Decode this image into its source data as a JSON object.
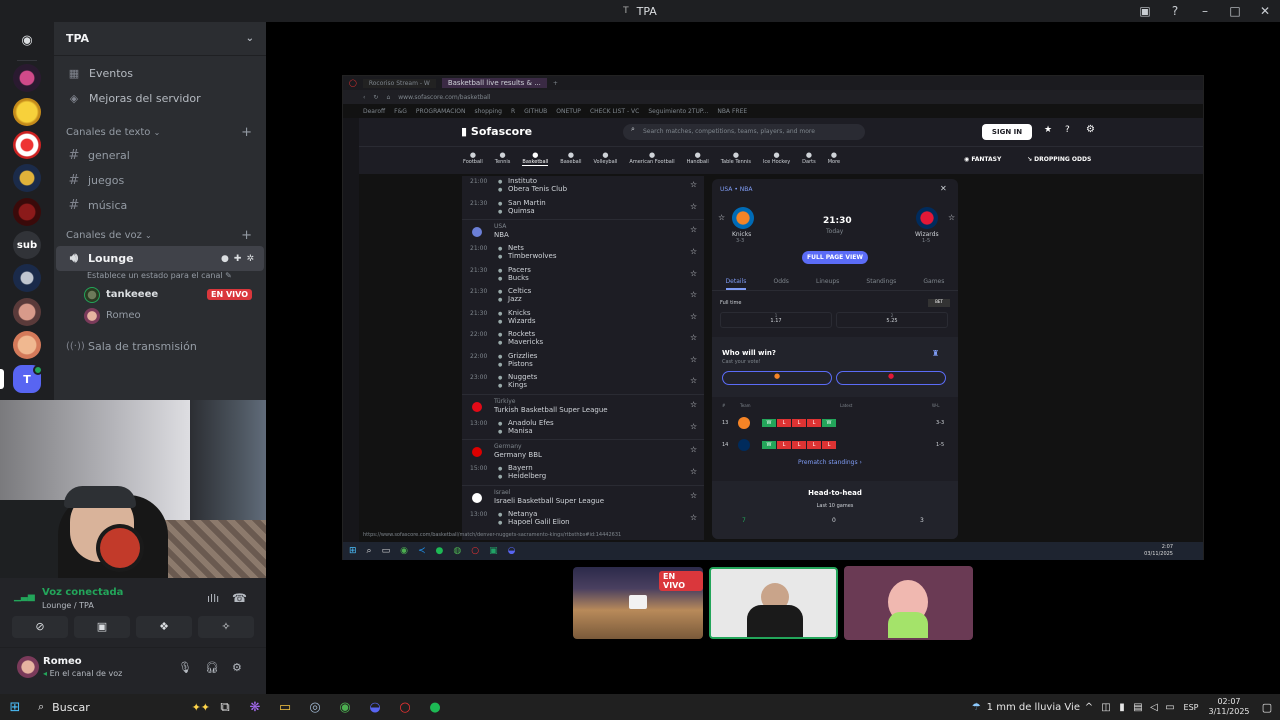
{
  "window": {
    "title": "TPA"
  },
  "server": {
    "name": "TPA"
  },
  "sidebar": {
    "items": [
      {
        "label": "Eventos",
        "icon": "calendar-icon"
      },
      {
        "label": "Mejoras del servidor",
        "icon": "boost-icon"
      }
    ],
    "text_category": "Canales de texto",
    "text_channels": [
      "general",
      "juegos",
      "música"
    ],
    "voice_category": "Canales de voz",
    "voice_channels": {
      "lounge": {
        "label": "Lounge",
        "status": "Establece un estado para el canal"
      },
      "stage": {
        "label": "Sala de transmisión"
      }
    },
    "voice_users": [
      {
        "name": "tankeeee",
        "badge": "EN VIVO"
      },
      {
        "name": "Romeo"
      }
    ]
  },
  "server_rail": {
    "sub_label": "sub",
    "t_label": "T"
  },
  "voice_panel": {
    "status": "Voz conectada",
    "location": "Lounge / TPA",
    "user": {
      "name": "Romeo",
      "status": "En el canal de voz"
    }
  },
  "stream": {
    "browser": {
      "tab1": "Rocoriso Stream - W",
      "tab2": "Basketball live results & ...",
      "url": "www.sofascore.com/basketball",
      "bookmarks": [
        "Dearoff",
        "F&G",
        "PROGRAMACION",
        "shopping",
        "R",
        "GITHUB",
        "ONETUP",
        "CHECK LIST - VC",
        "Seguimiento 2TUP...",
        "NBA FREE"
      ]
    },
    "sofascore": {
      "logo": "Sofascore",
      "search_placeholder": "Search matches, competitions, teams, players, and more",
      "sign_in": "SIGN IN",
      "sports": [
        "Football",
        "Tennis",
        "Basketball",
        "Baseball",
        "Volleyball",
        "American Football",
        "Handball",
        "Table Tennis",
        "Ice Hockey",
        "Darts",
        "More"
      ],
      "fantasy": "FANTASY",
      "dropping_odds": "DROPPING ODDS",
      "matches_top": [
        {
          "time": "21:00",
          "home": "Instituto",
          "away": "Obera Tenis Club"
        },
        {
          "time": "21:30",
          "home": "San Martin",
          "away": "Quimsa"
        }
      ],
      "nba_country": "USA",
      "nba_league": "NBA",
      "nba_matches": [
        {
          "time": "21:00",
          "home": "Nets",
          "away": "Timberwolves"
        },
        {
          "time": "21:30",
          "home": "Pacers",
          "away": "Bucks"
        },
        {
          "time": "21:30",
          "home": "Celtics",
          "away": "Jazz"
        },
        {
          "time": "21:30",
          "home": "Knicks",
          "away": "Wizards"
        },
        {
          "time": "22:00",
          "home": "Rockets",
          "away": "Mavericks"
        },
        {
          "time": "22:00",
          "home": "Grizzlies",
          "away": "Pistons"
        },
        {
          "time": "23:00",
          "home": "Nuggets",
          "away": "Kings"
        }
      ],
      "turkey_country": "Türkiye",
      "turkey_league": "Turkish Basketball Super League",
      "turkey_matches": [
        {
          "time": "13:00",
          "home": "Anadolu Efes",
          "away": "Manisa"
        }
      ],
      "germany_country": "Germany",
      "germany_league": "Germany BBL",
      "germany_matches": [
        {
          "time": "15:00",
          "home": "Bayern",
          "away": "Heidelberg"
        }
      ],
      "israel_country": "Israel",
      "israel_league": "Israeli Basketball Super League",
      "israel_matches": [
        {
          "time": "13:00",
          "home": "Netanya",
          "away": "Hapoel Galil Elion"
        }
      ],
      "detail": {
        "breadcrumb": "USA • NBA",
        "home": "Knicks",
        "home_record": "3-3",
        "away": "Wizards",
        "away_record": "1-5",
        "time": "21:30",
        "day": "Today",
        "full_page": "FULL PAGE VIEW",
        "tabs": [
          "Details",
          "Odds",
          "Lineups",
          "Standings",
          "Games"
        ],
        "full_time": "Full time",
        "odds": [
          {
            "label": "1",
            "value": "1.17"
          },
          {
            "label": "2",
            "value": "5.25"
          }
        ],
        "who_will_win": "Who will win?",
        "cast_vote": "Cast your vote!",
        "form_header": [
          "#",
          "Team",
          "Latest",
          "W-L"
        ],
        "form_rows": [
          {
            "rank": "13",
            "form": [
              "W",
              "L",
              "L",
              "L",
              "W"
            ],
            "wl": "3-3"
          },
          {
            "rank": "14",
            "form": [
              "W",
              "L",
              "L",
              "L",
              "L"
            ],
            "wl": "1-5"
          }
        ],
        "prematch": "Prematch standings",
        "h2h": "Head-to-head",
        "last_games": "Last 10 games",
        "h2h_home": "7",
        "h2h_draw": "0",
        "h2h_away": "3"
      },
      "status_url": "https://www.sofascore.com/basketball/match/denver-nuggets-sacramento-kings/rtbsthbs#id:14442631"
    },
    "taskbar_time": "2:07",
    "taskbar_date": "03/11/2025"
  },
  "thumbs": {
    "live": "EN VIVO"
  },
  "taskbar": {
    "search": "Buscar",
    "weather": "1 mm de lluvia Vie",
    "lang": "ESP",
    "time": "02:07",
    "date": "3/11/2025"
  },
  "colors": {
    "discord_dark": "#1e1f22",
    "sidebar": "#2b2d31",
    "live_red": "#da373c",
    "voice_green": "#23a55a",
    "sofa_blue": "#5b6cf7"
  }
}
